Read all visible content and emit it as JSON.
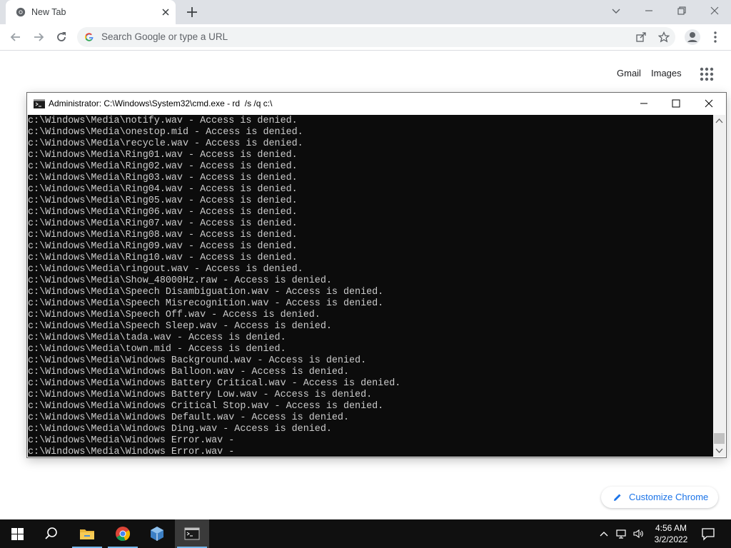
{
  "browser": {
    "tab_title": "New Tab",
    "omnibox_placeholder": "Search Google or type a URL",
    "ntp_links": [
      "Gmail",
      "Images"
    ],
    "customize_label": "Customize Chrome",
    "accent": "#1a73e8"
  },
  "cmd": {
    "title": "Administrator: C:\\Windows\\System32\\cmd.exe - rd  /s /q c:\\",
    "lines": [
      "c:\\Windows\\Media\\notify.wav - Access is denied.",
      "c:\\Windows\\Media\\onestop.mid - Access is denied.",
      "c:\\Windows\\Media\\recycle.wav - Access is denied.",
      "c:\\Windows\\Media\\Ring01.wav - Access is denied.",
      "c:\\Windows\\Media\\Ring02.wav - Access is denied.",
      "c:\\Windows\\Media\\Ring03.wav - Access is denied.",
      "c:\\Windows\\Media\\Ring04.wav - Access is denied.",
      "c:\\Windows\\Media\\Ring05.wav - Access is denied.",
      "c:\\Windows\\Media\\Ring06.wav - Access is denied.",
      "c:\\Windows\\Media\\Ring07.wav - Access is denied.",
      "c:\\Windows\\Media\\Ring08.wav - Access is denied.",
      "c:\\Windows\\Media\\Ring09.wav - Access is denied.",
      "c:\\Windows\\Media\\Ring10.wav - Access is denied.",
      "c:\\Windows\\Media\\ringout.wav - Access is denied.",
      "c:\\Windows\\Media\\Show_48000Hz.raw - Access is denied.",
      "c:\\Windows\\Media\\Speech Disambiguation.wav - Access is denied.",
      "c:\\Windows\\Media\\Speech Misrecognition.wav - Access is denied.",
      "c:\\Windows\\Media\\Speech Off.wav - Access is denied.",
      "c:\\Windows\\Media\\Speech Sleep.wav - Access is denied.",
      "c:\\Windows\\Media\\tada.wav - Access is denied.",
      "c:\\Windows\\Media\\town.mid - Access is denied.",
      "c:\\Windows\\Media\\Windows Background.wav - Access is denied.",
      "c:\\Windows\\Media\\Windows Balloon.wav - Access is denied.",
      "c:\\Windows\\Media\\Windows Battery Critical.wav - Access is denied.",
      "c:\\Windows\\Media\\Windows Battery Low.wav - Access is denied.",
      "c:\\Windows\\Media\\Windows Critical Stop.wav - Access is denied.",
      "c:\\Windows\\Media\\Windows Default.wav - Access is denied.",
      "c:\\Windows\\Media\\Windows Ding.wav - Access is denied.",
      "c:\\Windows\\Media\\Windows Error.wav -",
      "c:\\Windows\\Media\\Windows Error.wav -"
    ]
  },
  "taskbar": {
    "time": "4:56 AM",
    "date": "3/2/2022",
    "items": [
      "start-icon",
      "search-icon",
      "file-explorer-icon",
      "chrome-icon",
      "virtualbox-icon",
      "cmd-icon"
    ]
  }
}
